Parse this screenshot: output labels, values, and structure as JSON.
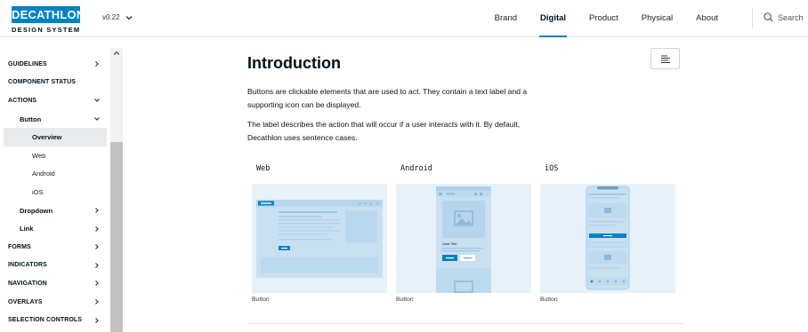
{
  "header": {
    "logo_text": "DECATHLON",
    "logo_sub": "DESIGN SYSTEM",
    "version": "v0.22",
    "nav": [
      "Brand",
      "Digital",
      "Product",
      "Physical",
      "About"
    ],
    "active_nav": "Digital",
    "search_label": "Search"
  },
  "sidebar": {
    "items": [
      {
        "label": "GUIDELINES",
        "level": 0,
        "chevron": "right"
      },
      {
        "label": "COMPONENT STATUS",
        "level": 0,
        "chevron": ""
      },
      {
        "label": "ACTIONS",
        "level": 0,
        "chevron": "down"
      },
      {
        "label": "Button",
        "level": 1,
        "chevron": "down"
      },
      {
        "label": "Overview",
        "level": 2,
        "chevron": "",
        "selected": true
      },
      {
        "label": "Web",
        "level": 2,
        "chevron": ""
      },
      {
        "label": "Android",
        "level": 2,
        "chevron": ""
      },
      {
        "label": "iOS",
        "level": 2,
        "chevron": ""
      },
      {
        "label": "Dropdown",
        "level": 1,
        "chevron": "right"
      },
      {
        "label": "Link",
        "level": 1,
        "chevron": "right"
      },
      {
        "label": "FORMS",
        "level": 0,
        "chevron": "right"
      },
      {
        "label": "INDICATORS",
        "level": 0,
        "chevron": "right"
      },
      {
        "label": "NAVIGATION",
        "level": 0,
        "chevron": "right"
      },
      {
        "label": "OVERLAYS",
        "level": 0,
        "chevron": "right"
      },
      {
        "label": "SELECTION CONTROLS",
        "level": 0,
        "chevron": "right"
      }
    ]
  },
  "main": {
    "title": "Introduction",
    "paragraph1": "Buttons are clickable elements that are used to act. They contain a text label and a supporting icon can be displayed.",
    "paragraph2": "The label describes the action that will occur if a user interacts with it. By default, Decathlon uses sentence cases.",
    "cards": [
      {
        "label": "Web",
        "caption": "Button"
      },
      {
        "label": "Android",
        "caption": "Button"
      },
      {
        "label": "iOS",
        "caption": "Button"
      }
    ],
    "android_preview": {
      "card_title": "Card Title"
    }
  },
  "colors": {
    "brand": "#0082c3",
    "preview_bg": "#e6f1f9",
    "selected_bg": "#e9eaeb"
  }
}
